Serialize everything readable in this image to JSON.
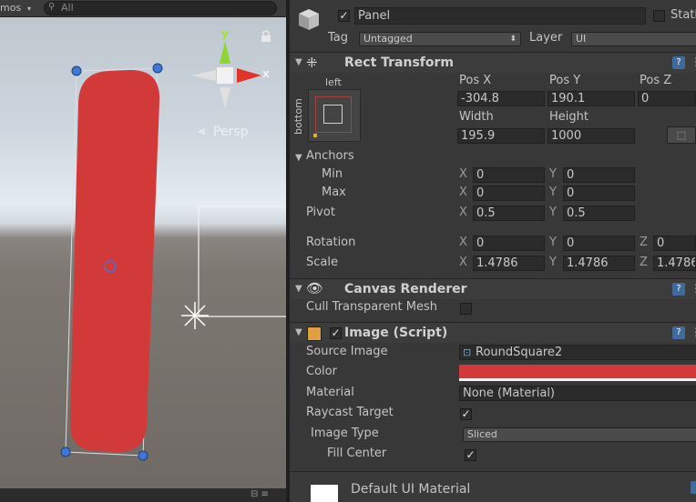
{
  "scene": {
    "toolbar_left": "mos",
    "search_placeholder": "All",
    "gizmo": {
      "y": "y",
      "x": "x",
      "persp": "Persp"
    }
  },
  "inspector": {
    "object": {
      "name": "Panel",
      "static_label": "Stati",
      "tag_label": "Tag",
      "tag_value": "Untagged",
      "layer_label": "Layer",
      "layer_value": "UI"
    },
    "rect_transform": {
      "title": "Rect Transform",
      "anchor_left": "left",
      "anchor_bottom": "bottom",
      "pos_x_label": "Pos X",
      "pos_y_label": "Pos Y",
      "pos_z_label": "Pos Z",
      "pos_x": "-304.8",
      "pos_y": "190.1",
      "pos_z": "0",
      "width_label": "Width",
      "height_label": "Height",
      "width": "195.9",
      "height": "1000",
      "anchors_label": "Anchors",
      "min_label": "Min",
      "max_label": "Max",
      "min_x": "0",
      "min_y": "0",
      "max_x": "0",
      "max_y": "0",
      "pivot_label": "Pivot",
      "pivot_x": "0.5",
      "pivot_y": "0.5",
      "rotation_label": "Rotation",
      "rot_x": "0",
      "rot_y": "0",
      "rot_z": "0",
      "scale_label": "Scale",
      "scale_x": "1.4786",
      "scale_y": "1.4786",
      "scale_z": "1.4786",
      "axis_x": "X",
      "axis_y": "Y",
      "axis_z": "Z"
    },
    "canvas_renderer": {
      "title": "Canvas Renderer",
      "cull_label": "Cull Transparent Mesh"
    },
    "image_script": {
      "title": "Image (Script)",
      "source_label": "Source Image",
      "source_value": "RoundSquare2",
      "color_label": "Color",
      "color_value": "#d23a3a",
      "material_label": "Material",
      "material_value": "None (Material)",
      "raycast_label": "Raycast Target",
      "image_type_label": "Image Type",
      "image_type_value": "Sliced",
      "fill_center_label": "Fill Center"
    },
    "footer": {
      "material_name": "Default UI Material"
    }
  }
}
